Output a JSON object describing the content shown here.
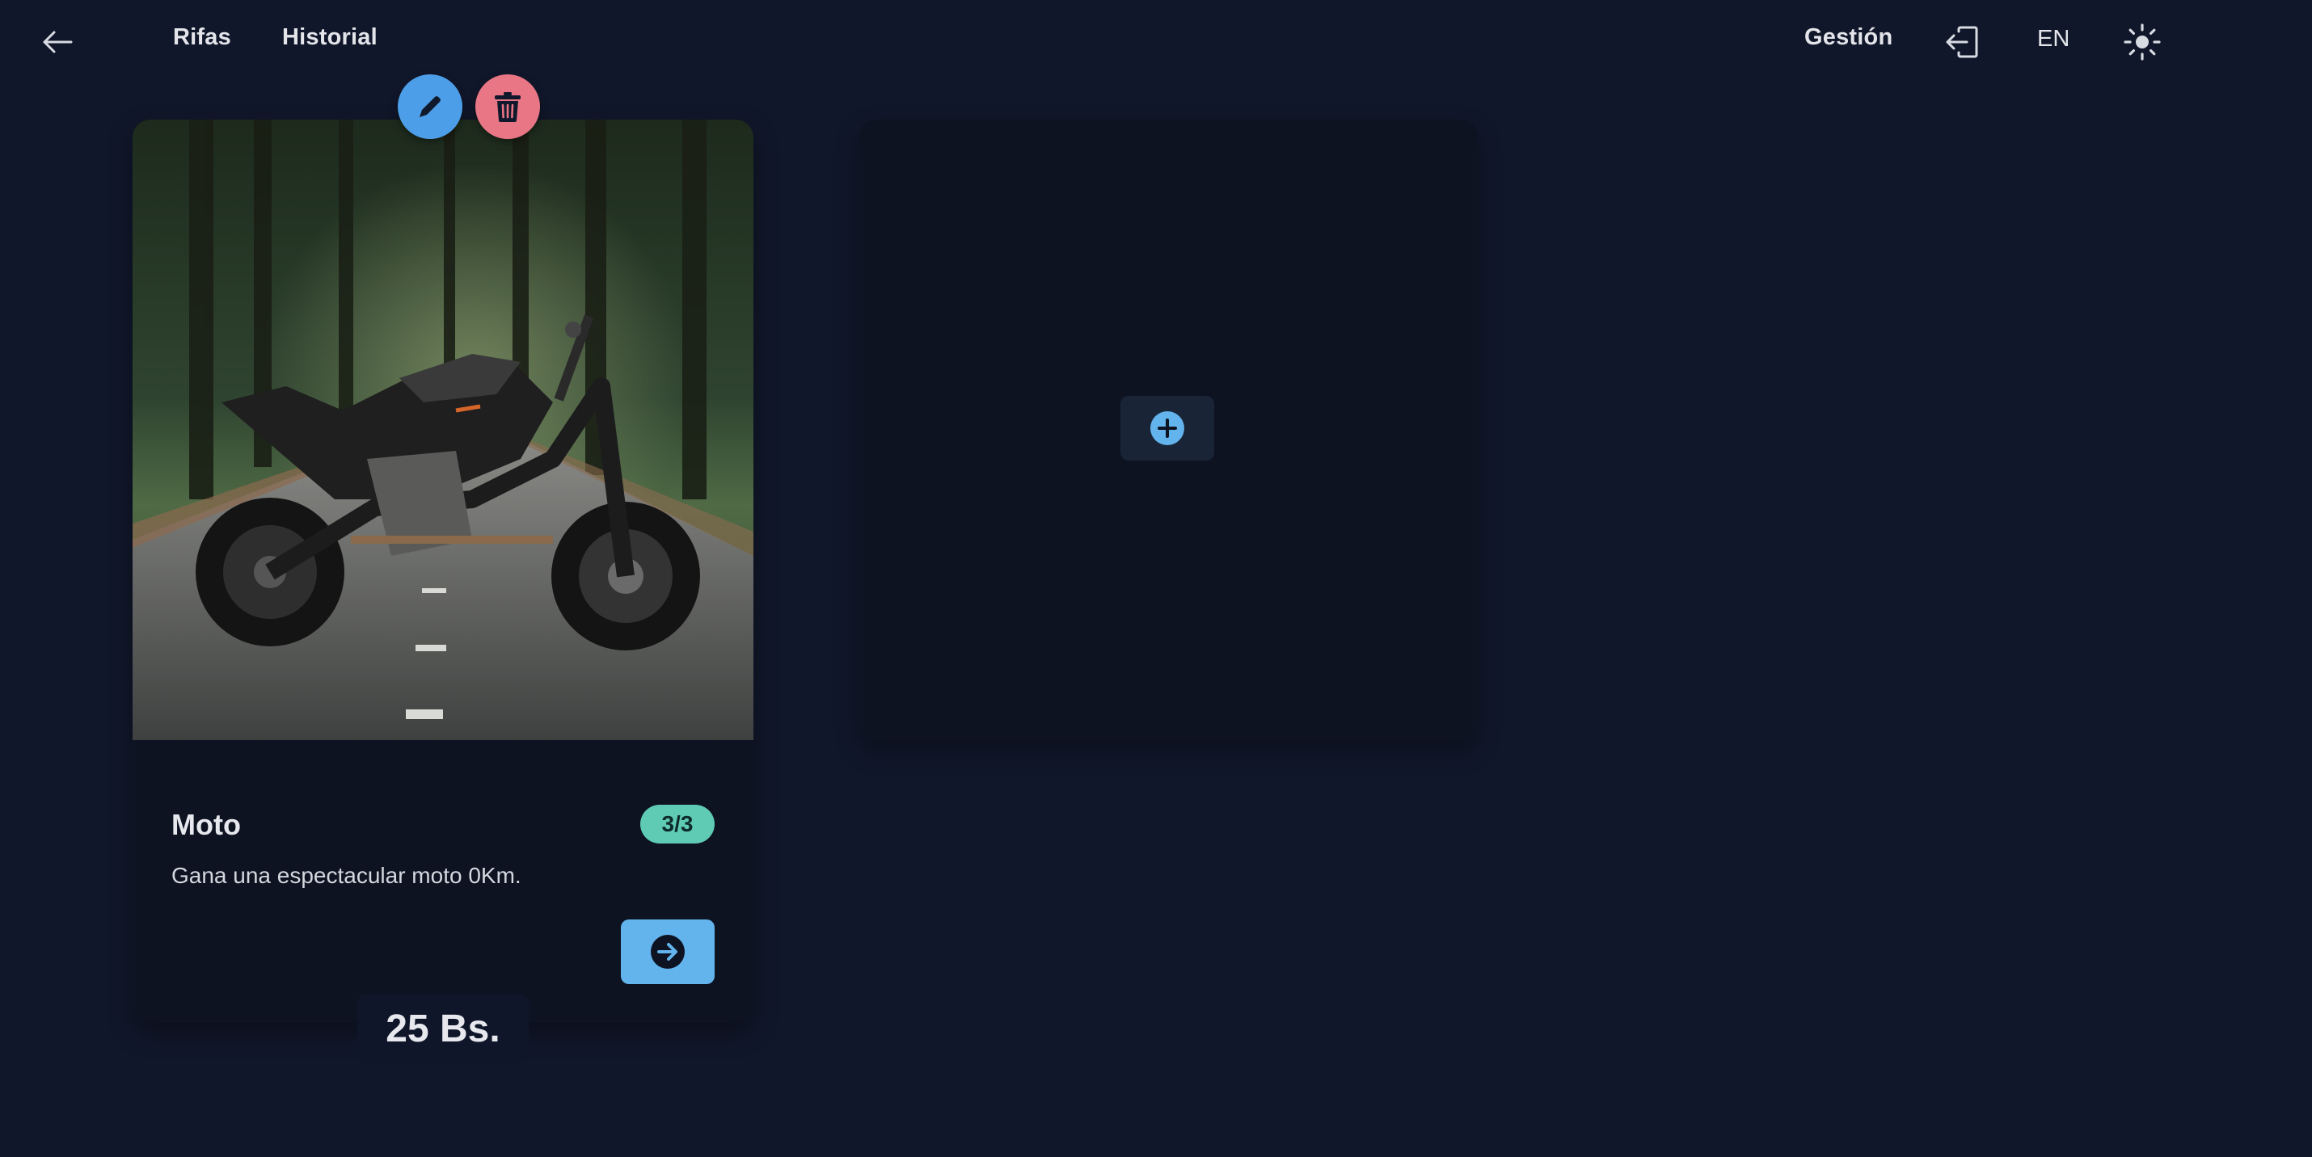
{
  "nav": {
    "rifas": "Rifas",
    "historial": "Historial",
    "gestion": "Gestión",
    "lang": "EN"
  },
  "raffle": {
    "title": "Moto",
    "badge": "3/3",
    "description": "Gana una espectacular moto 0Km.",
    "price": "25 Bs."
  },
  "icons": {
    "back": "arrow-left-icon",
    "logout": "logout-icon",
    "theme": "sun-icon",
    "edit": "pencil-icon",
    "delete": "trash-icon",
    "go": "arrow-right-circle-icon",
    "add": "plus-circle-icon"
  },
  "colors": {
    "background": "#11172a",
    "card": "#0e1322",
    "accent_blue": "#63b3ed",
    "edit_blue": "#4d9ee8",
    "delete_pink": "#e87685",
    "badge_green": "#5fcbb4"
  }
}
